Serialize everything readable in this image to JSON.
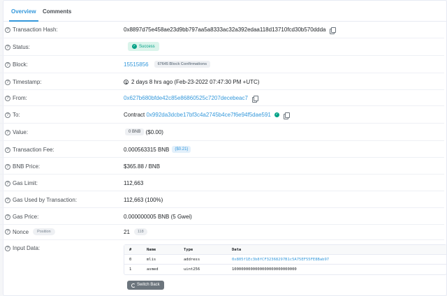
{
  "tabs": [
    {
      "label": "Overview",
      "active": true
    },
    {
      "label": "Comments",
      "active": false
    }
  ],
  "fields": {
    "tx_hash": {
      "label": "Transaction Hash:",
      "value": "0x8897d75e458ae23d9bb797aa5a8333ac32a392edaa118d13710fcd30b570ddda"
    },
    "status": {
      "label": "Status:",
      "value": "Success"
    },
    "block": {
      "label": "Block:",
      "value": "15515856",
      "confirmations": "67645 Block Confirmations"
    },
    "timestamp": {
      "label": "Timestamp:",
      "value": "2 days 8 hrs ago (Feb-23-2022 07:47:30 PM +UTC)"
    },
    "from": {
      "label": "From:",
      "value": "0x627b680bfde42c85e86860525c7207decebeac7"
    },
    "to": {
      "label": "To:",
      "prefix": "Contract",
      "value": "0x992da3dcbe17bf3c4a2745b4ce7f6e94f5dae591"
    },
    "value": {
      "label": "Value:",
      "amount": "0 BNB",
      "usd": "($0.00)"
    },
    "tx_fee": {
      "label": "Transaction Fee:",
      "value": "0.000563315 BNB",
      "usd": "($0.21)"
    },
    "bnb_price": {
      "label": "BNB Price:",
      "value": "$365.88 / BNB"
    },
    "gas_limit": {
      "label": "Gas Limit:",
      "value": "112,663"
    },
    "gas_used": {
      "label": "Gas Used by Transaction:",
      "value": "112,663 (100%)"
    },
    "gas_price": {
      "label": "Gas Price:",
      "value": "0.000000005 BNB (5 Gwei)"
    },
    "nonce": {
      "label": "Nonce",
      "position_label": "Position",
      "value": "21",
      "position": "118"
    },
    "input": {
      "label": "Input Data:"
    }
  },
  "input_table": {
    "headers": [
      "#",
      "Name",
      "Type",
      "Data"
    ],
    "rows": [
      [
        "0",
        "mlis",
        "address",
        "0x805f1Ec3b8fCF32368297B1c5A75EF55FE8Bab97"
      ],
      [
        "1",
        "asmed",
        "uint256",
        "1000000000000000000000000000"
      ]
    ]
  },
  "switch_back_label": "Switch Back",
  "colors": {
    "link": "#3498db",
    "success": "#00a186"
  }
}
